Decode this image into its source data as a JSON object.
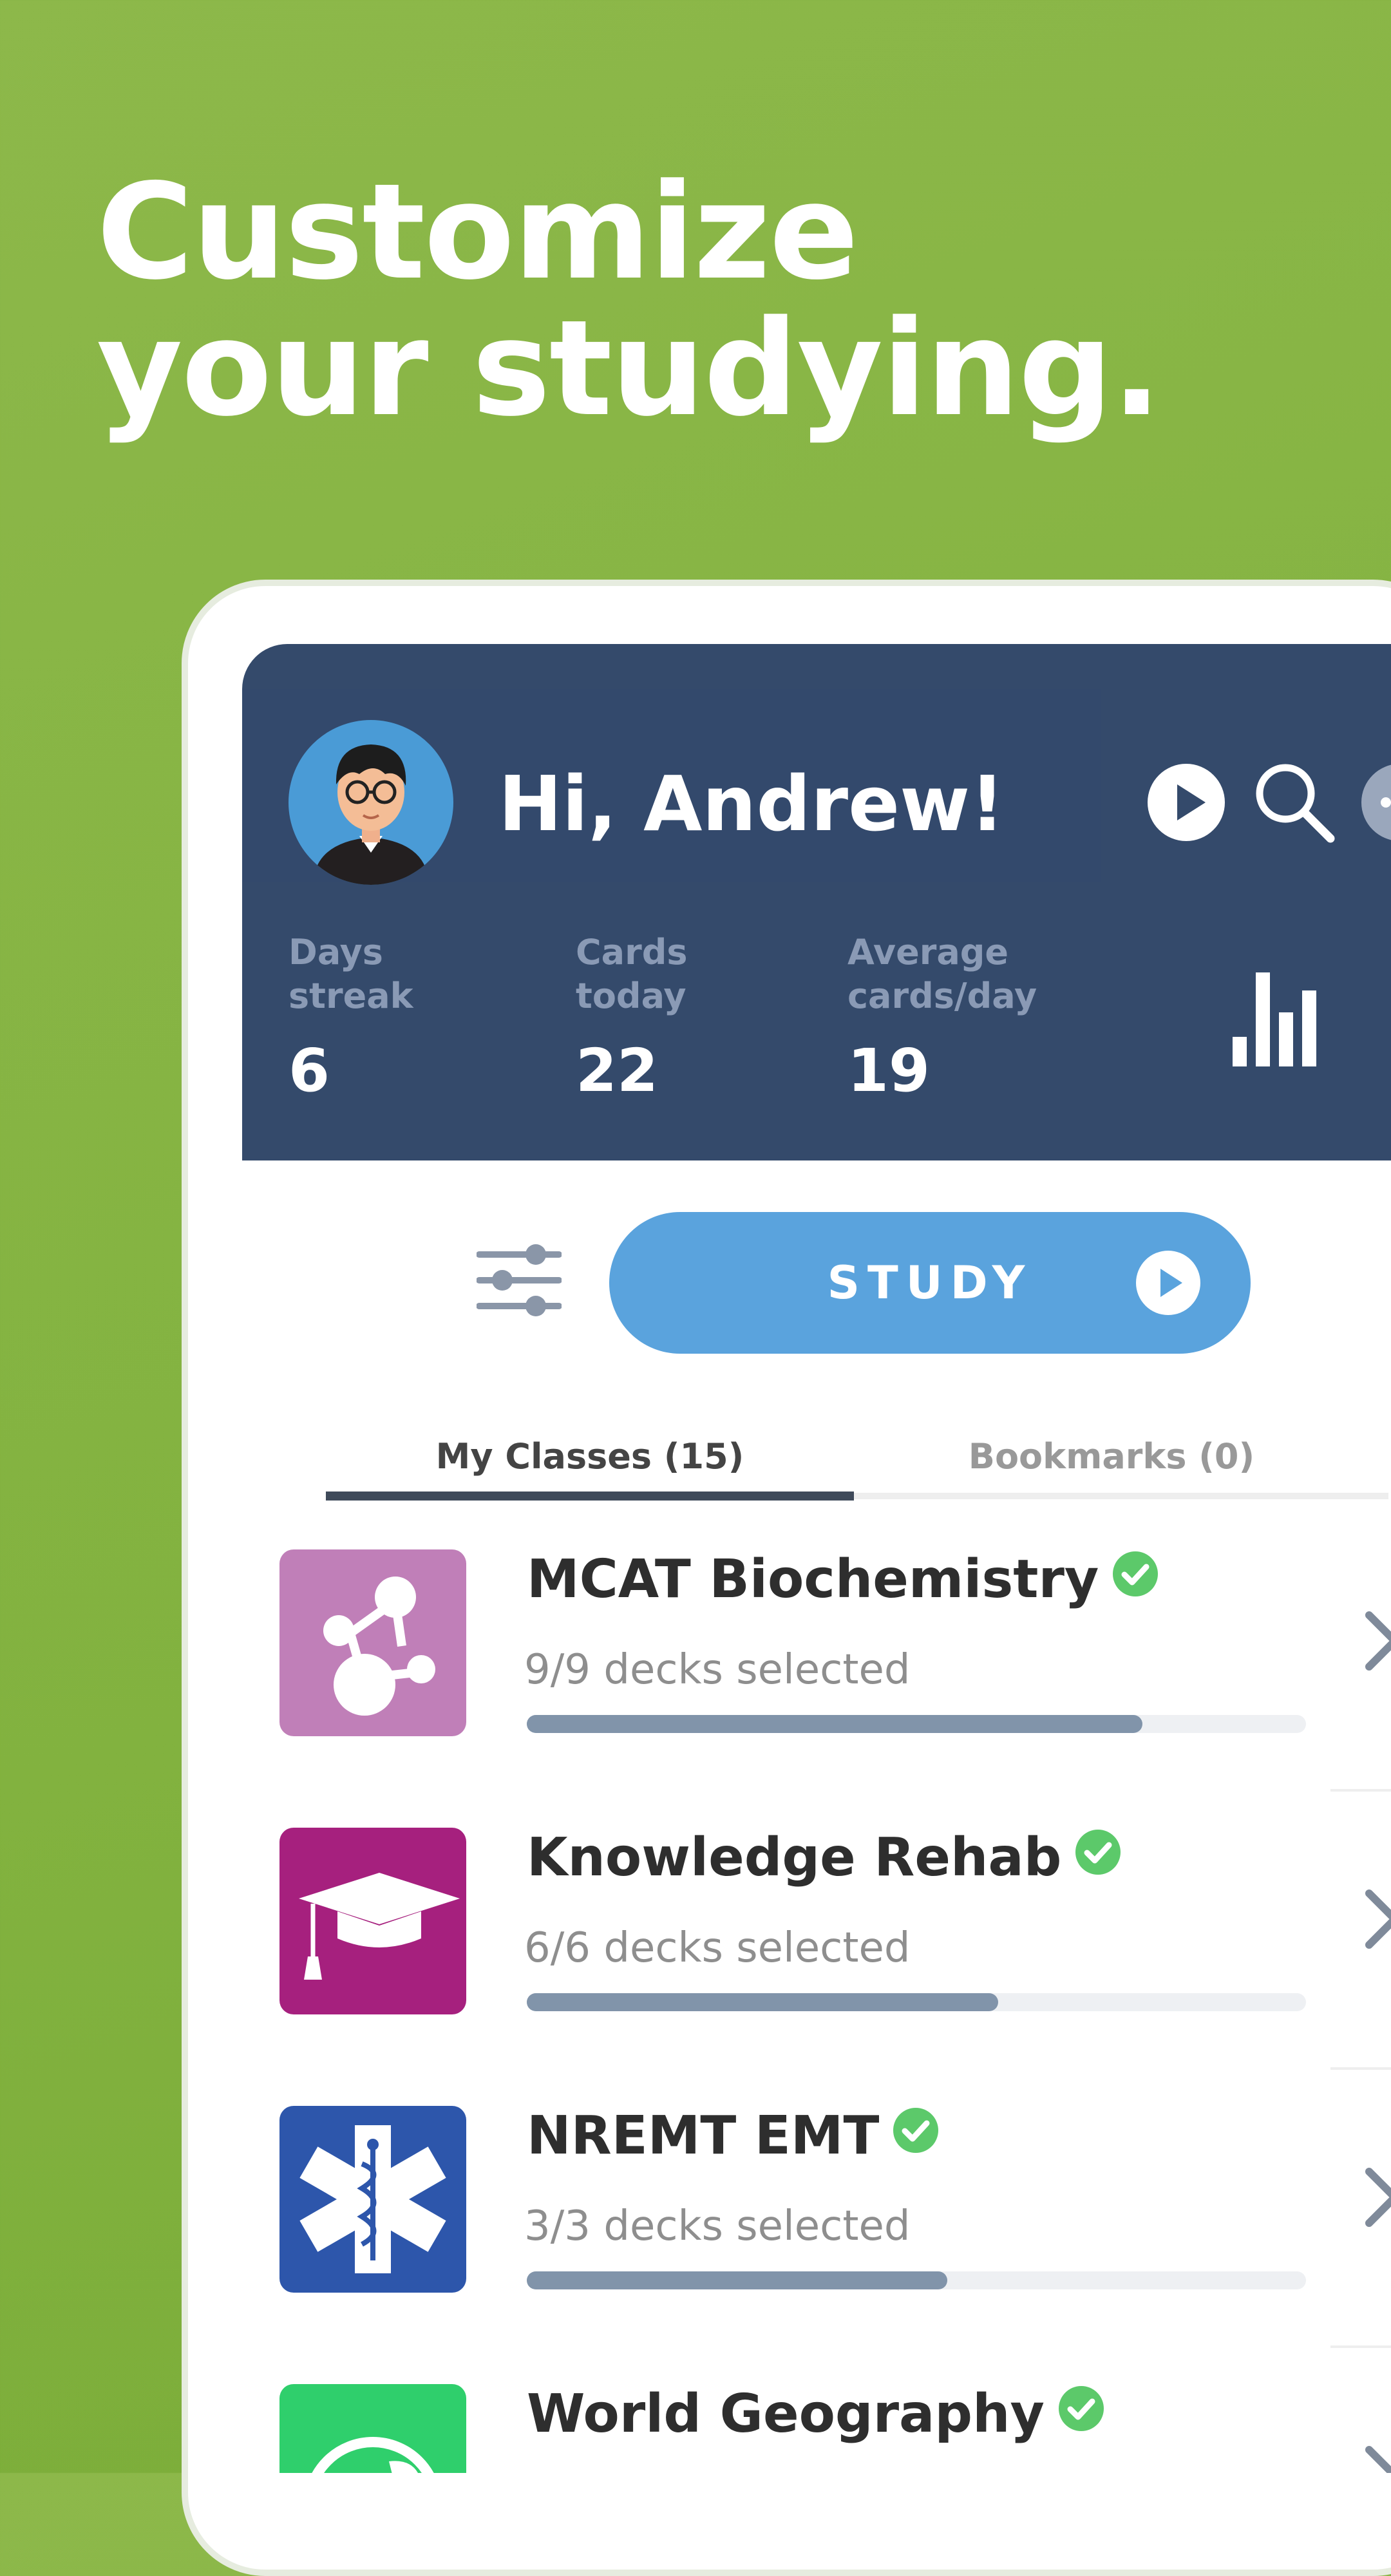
{
  "headline": {
    "line1": "Customize",
    "line2": "your studying."
  },
  "header": {
    "greeting": "Hi, Andrew!",
    "icons": [
      "play-icon",
      "search-icon",
      "more-icon"
    ],
    "stats": [
      {
        "label": "Days\nstreak",
        "value": "6"
      },
      {
        "label": "Cards\ntoday",
        "value": "22"
      },
      {
        "label": "Average\ncards/day",
        "value": "19"
      }
    ]
  },
  "study_button": {
    "label": "STUDY"
  },
  "tabs": [
    {
      "label": "My Classes (15)",
      "active": true
    },
    {
      "label": "Bookmarks (0)",
      "active": false
    }
  ],
  "classes": [
    {
      "title": "MCAT Biochemistry",
      "subtitle": "9/9 decks selected",
      "progress": 0.79,
      "icon": "molecule-icon",
      "color": "#c07fb8"
    },
    {
      "title": "Knowledge Rehab",
      "subtitle": "6/6 decks selected",
      "progress": 0.605,
      "icon": "graduation-cap-icon",
      "color": "#a6207e"
    },
    {
      "title": "NREMT EMT",
      "subtitle": "3/3 decks selected",
      "progress": 0.54,
      "icon": "star-of-life-icon",
      "color": "#2d56ab"
    },
    {
      "title": "World Geography",
      "subtitle": "",
      "progress": 0,
      "icon": "globe-icon",
      "color": "#2fcf6c"
    }
  ],
  "colors": {
    "background_green": "#86b43f",
    "header_navy": "#344a6b",
    "study_blue": "#5aa3dd",
    "check_green": "#5cc96a",
    "progress_fill": "#8194aa"
  }
}
